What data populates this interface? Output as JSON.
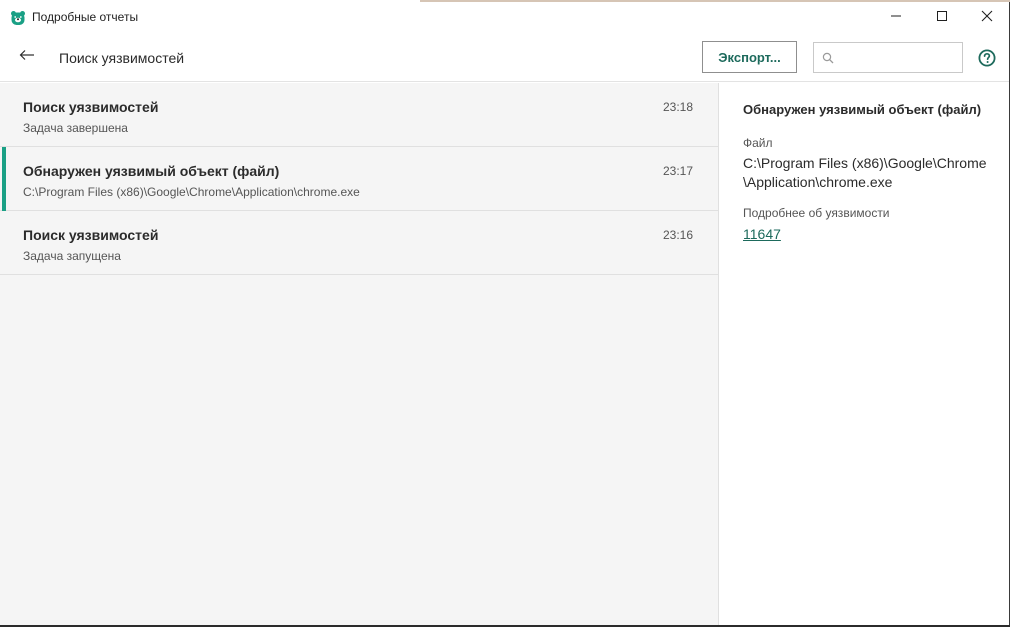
{
  "window": {
    "title": "Подробные отчеты",
    "accent_color": "#1aa085",
    "icons": {
      "app": "kaspersky-bear-icon",
      "minimize": "minimize-icon",
      "maximize": "maximize-icon",
      "close": "close-icon"
    }
  },
  "header": {
    "title": "Поиск уязвимостей",
    "back_icon": "arrow-left-icon",
    "export_label": "Экспорт...",
    "search_placeholder": "",
    "search_value": "",
    "search_icon": "search-icon",
    "help_icon": "help-circle-icon"
  },
  "events": [
    {
      "title": "Поиск уязвимостей",
      "subtitle": "Задача завершена",
      "time": "23:18",
      "selected": false
    },
    {
      "title": "Обнаружен уязвимый объект (файл)",
      "subtitle": "C:\\Program Files (x86)\\Google\\Chrome\\Application\\chrome.exe",
      "time": "23:17",
      "selected": true
    },
    {
      "title": "Поиск уязвимостей",
      "subtitle": "Задача запущена",
      "time": "23:16",
      "selected": false
    }
  ],
  "details": {
    "title": "Обнаружен уязвимый объект (файл)",
    "file_label": "Файл",
    "file_value": "C:\\Program Files (x86)\\Google\\Chrome\\Application\\chrome.exe",
    "more_label": "Подробнее об уязвимости",
    "vulnerability_link": "11647"
  }
}
